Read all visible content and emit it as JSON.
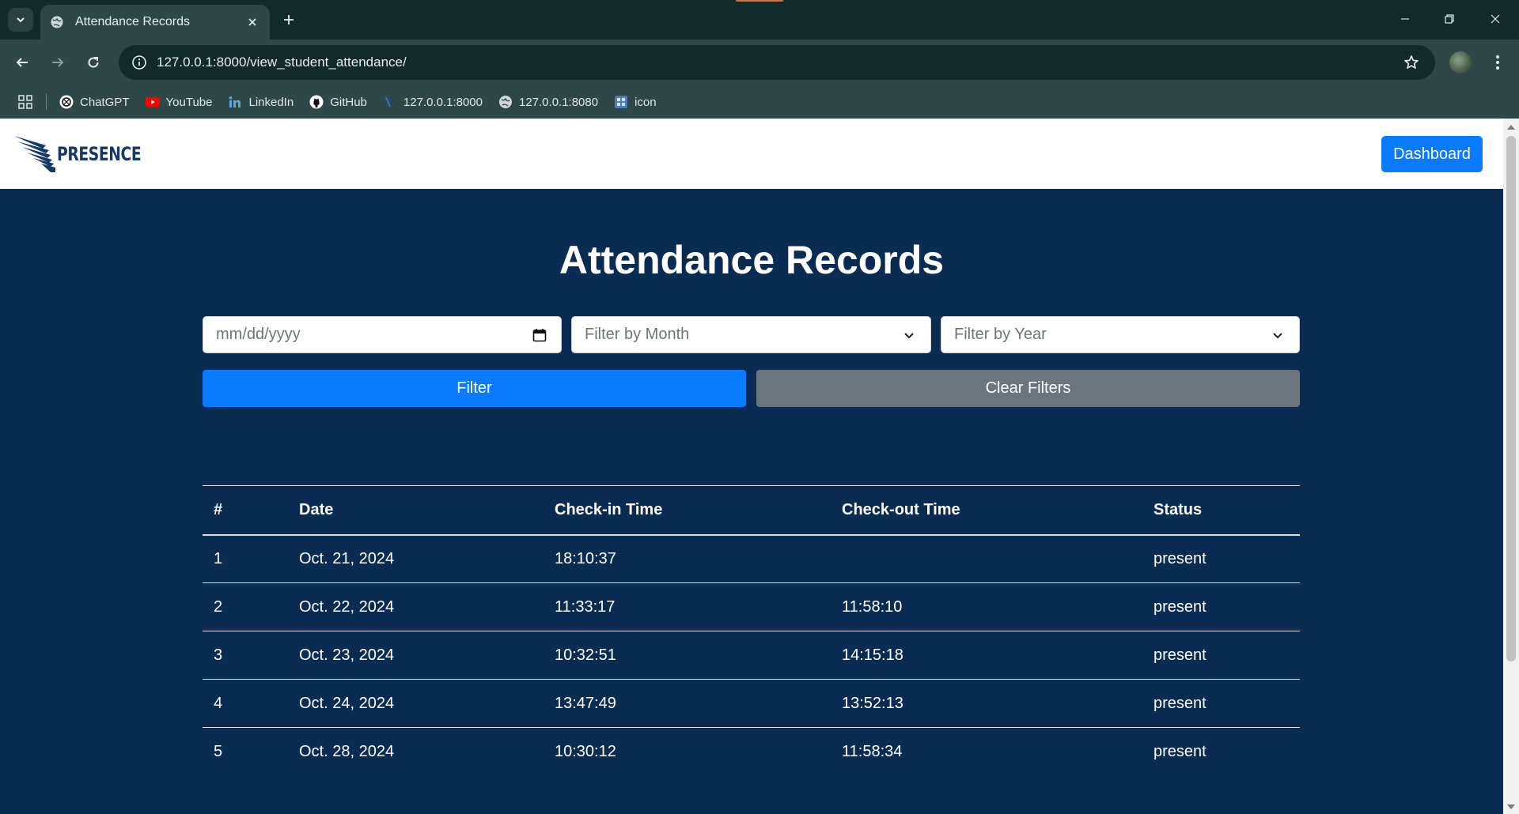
{
  "browser": {
    "tab_title": "Attendance Records",
    "url": "127.0.0.1:8000/view_student_attendance/",
    "bookmarks": [
      {
        "label": "ChatGPT",
        "icon": "chatgpt-icon"
      },
      {
        "label": "YouTube",
        "icon": "youtube-icon"
      },
      {
        "label": "LinkedIn",
        "icon": "linkedin-icon"
      },
      {
        "label": "GitHub",
        "icon": "github-icon"
      },
      {
        "label": "127.0.0.1:8000",
        "icon": "django-icon"
      },
      {
        "label": "127.0.0.1:8080",
        "icon": "globe-icon"
      },
      {
        "label": "icon",
        "icon": "image-icon"
      }
    ]
  },
  "nav": {
    "brand": "PRESENCE",
    "dashboard_label": "Dashboard"
  },
  "main": {
    "title": "Attendance Records",
    "date_placeholder": "mm/dd/yyyy",
    "month_placeholder": "Filter by Month",
    "year_placeholder": "Filter by Year",
    "filter_label": "Filter",
    "clear_label": "Clear Filters"
  },
  "table": {
    "headers": [
      "#",
      "Date",
      "Check-in Time",
      "Check-out Time",
      "Status"
    ],
    "rows": [
      [
        "1",
        "Oct. 21, 2024",
        "18:10:37",
        "",
        "present"
      ],
      [
        "2",
        "Oct. 22, 2024",
        "11:33:17",
        "11:58:10",
        "present"
      ],
      [
        "3",
        "Oct. 23, 2024",
        "10:32:51",
        "14:15:18",
        "present"
      ],
      [
        "4",
        "Oct. 24, 2024",
        "13:47:49",
        "13:52:13",
        "present"
      ],
      [
        "5",
        "Oct. 28, 2024",
        "10:30:12",
        "11:58:34",
        "present"
      ]
    ]
  },
  "colors": {
    "page_bg": "#0b2c52",
    "primary": "#0a7bff",
    "secondary": "#6c757d",
    "brand": "#17376b"
  }
}
